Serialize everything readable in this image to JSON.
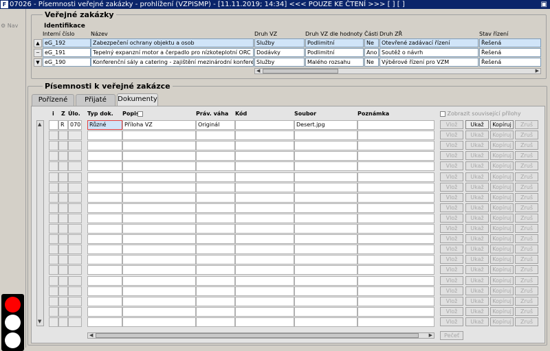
{
  "window": {
    "title": "07026 - Písemnosti veřejné zakázky - prohlížení (VZPISMP) - [11.11.2019; 14:34] <<< POUZE KE ČTENÍ >>>  [ ]  [ ]",
    "app_icon": "F"
  },
  "sidebar": {
    "nav_label": "Nav"
  },
  "zakazky": {
    "title": "Veřejné zakázky",
    "subtitle": "Identifikace",
    "headers": [
      "Interní číslo",
      "Název",
      "Druh VZ",
      "Druh VZ dle hodnoty",
      "Části",
      "Druh ZŘ",
      "Stav řízení"
    ],
    "rows": [
      [
        "eG_192",
        "Zabezpečení ochrany objektu a osob",
        "Služby",
        "Podlimitní",
        "Ne",
        "Otevřené zadávací řízení",
        "Řešená"
      ],
      [
        "eG_191",
        "Tepelný expanzní motor a čerpadlo pro nízkoteplotní ORC",
        "Dodávky",
        "Podlimitní",
        "Ano",
        "Soutěž o návrh",
        "Řešená"
      ],
      [
        "eG_190",
        "Konferenční sály a catering - zajištění mezinárodní konference",
        "Služby",
        "Malého rozsahu",
        "Ne",
        "Výběrové řízení pro VZM",
        "Řešená"
      ]
    ]
  },
  "pisemnosti": {
    "title": "Písemnosti k veřejné zakázce",
    "tabs": [
      "Pořízené",
      "Přijaté",
      "Dokumenty"
    ],
    "headers": [
      "i",
      "Z",
      "Úlo.",
      "Typ dok.",
      "Popis",
      "Práv. váha",
      "Kód",
      "Soubor",
      "Poznámka"
    ],
    "show_related_label": "Zobrazit související přílohy",
    "first_row": [
      "",
      "R",
      "070",
      "Různé",
      "Příloha VZ",
      "Originál",
      "",
      "Desert.jpg",
      ""
    ],
    "buttons": {
      "vloz": "Vlož",
      "ukaz": "Ukaž",
      "kopiruj": "Kopíruj",
      "zrus": "Zruš"
    },
    "pecet_label": "Pečeť"
  }
}
